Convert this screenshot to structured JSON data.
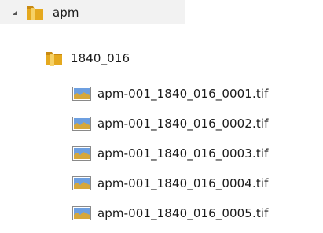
{
  "tree": {
    "root": {
      "label": "apm",
      "expanded": true,
      "icon": "folder-icon"
    },
    "folder": {
      "label": "1840_016",
      "icon": "folder-icon"
    },
    "files": [
      {
        "label": "apm-001_1840_016_0001.tif",
        "icon": "image-file-icon"
      },
      {
        "label": "apm-001_1840_016_0002.tif",
        "icon": "image-file-icon"
      },
      {
        "label": "apm-001_1840_016_0003.tif",
        "icon": "image-file-icon"
      },
      {
        "label": "apm-001_1840_016_0004.tif",
        "icon": "image-file-icon"
      },
      {
        "label": "apm-001_1840_016_0005.tif",
        "icon": "image-file-icon"
      }
    ]
  },
  "colors": {
    "folder": "#e5a91f",
    "folder_light": "#f7d36a",
    "expander": "#555555",
    "image_sky": "#6d9fe0",
    "image_ground": "#d6a73b"
  }
}
